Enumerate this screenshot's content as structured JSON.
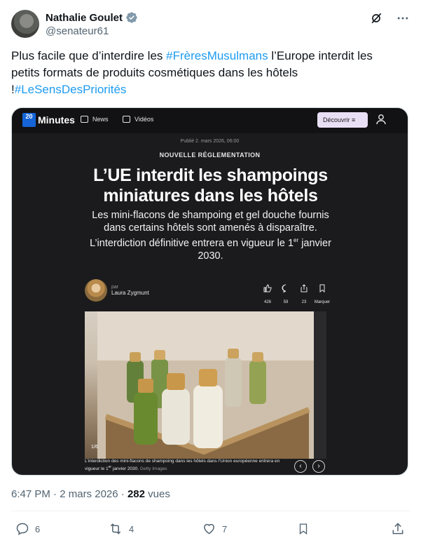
{
  "author": {
    "name": "Nathalie Goulet",
    "handle": "@senateur61"
  },
  "tweet": {
    "text_1": "Plus facile que d’interdire les ",
    "hashtag_1": "#FrèresMusulmans",
    "text_2": " l’Europe interdit les petits formats de produits cosmétiques dans les hôtels !",
    "hashtag_2": "#LeSensDesPriorités"
  },
  "article": {
    "site_logo_box": "20",
    "site_name": "Minutes",
    "nav_news": "News",
    "nav_videos": "Vidéos",
    "discover_label": "Découvrir",
    "published": "Publié 2. mars 2026, 06:00",
    "kicker": "NOUVELLE RÉGLEMENTATION",
    "headline": "L’UE interdit les shampoings miniatures dans les hôtels",
    "chapo_1": "Les mini-flacons de shampoing et gel douche fournis dans certains hôtels sont amenés à disparaître. L’interdiction définitive entrera en vigueur le 1",
    "chapo_sup": "er",
    "chapo_2": " janvier 2030.",
    "author_prefix": "par",
    "author_name": "Laura Zygmunt",
    "likes": "426",
    "comments": "59",
    "shares": "23",
    "bookmark_label": "Marquer",
    "photo_counter": "1/6",
    "caption_1": "L’interdiction des mini-flacons de shampoing dans les hôtels dans l’Union européenne entrera en vigueur le 1",
    "caption_sup": "er",
    "caption_2": " janvier 2030. ",
    "caption_credit": "Getty Images"
  },
  "meta": {
    "time": "6:47 PM",
    "sep": " · ",
    "date": "2 mars 2026",
    "views_count": "282",
    "views_label": " vues"
  },
  "actions": {
    "replies": "6",
    "reposts": "4",
    "likes": "7"
  },
  "colors": {
    "link": "#1d9bf0",
    "secondary": "#536471",
    "verified": "#829aab",
    "discover_bg": "#e9dff5"
  }
}
